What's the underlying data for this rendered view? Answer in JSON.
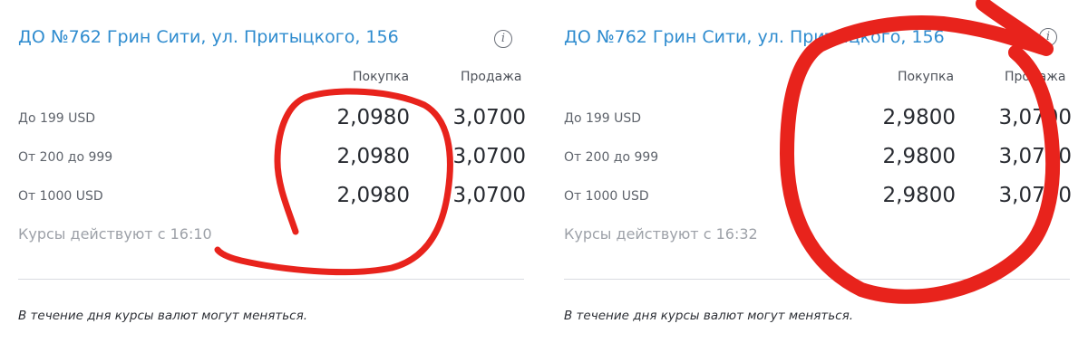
{
  "panels": [
    {
      "branch": "ДО №762 Грин Сити, ул. Притыцкого, 156",
      "col_buy": "Покупка",
      "col_sell": "Продажа",
      "rows": [
        {
          "label": "До 199 USD",
          "buy": "2,0980",
          "sell": "3,0700"
        },
        {
          "label": "От 200 до 999",
          "buy": "2,0980",
          "sell": "3,0700"
        },
        {
          "label": "От 1000 USD",
          "buy": "2,0980",
          "sell": "3,0700"
        }
      ],
      "valid_from": "Курсы действуют с 16:10",
      "disclaimer": "В течение дня курсы валют могут меняться."
    },
    {
      "branch": "ДО №762 Грин Сити, ул. Притыцкого, 156",
      "col_buy": "Покупка",
      "col_sell": "Продажа",
      "rows": [
        {
          "label": "До 199 USD",
          "buy": "2,9800",
          "sell": "3,0700"
        },
        {
          "label": "От 200 до 999",
          "buy": "2,9800",
          "sell": "3,0700"
        },
        {
          "label": "От 1000 USD",
          "buy": "2,9800",
          "sell": "3,0700"
        }
      ],
      "valid_from": "Курсы действуют с 16:32",
      "disclaimer": "В течение дня курсы валют могут меняться."
    }
  ],
  "icons": {
    "info": "info-icon",
    "info_glyph": "i"
  },
  "colors": {
    "link": "#2f8ccf",
    "rate_text": "#272a30",
    "muted_text": "#9da1a8",
    "annotation_marker": "#e8231c"
  }
}
